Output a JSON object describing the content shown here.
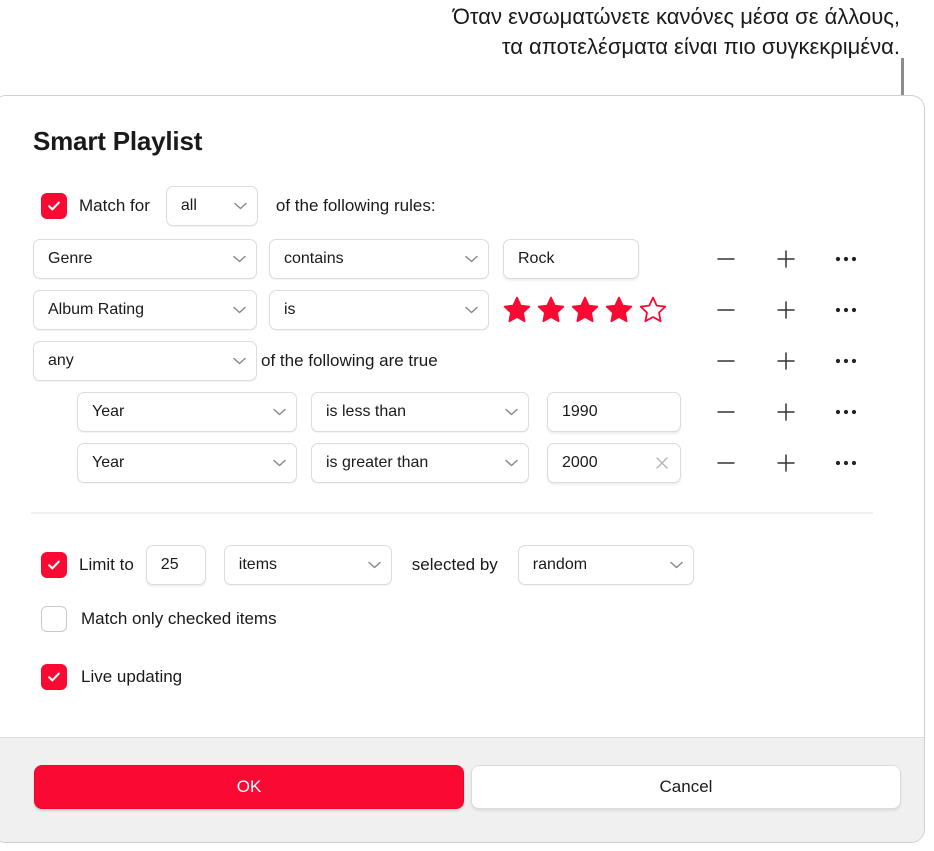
{
  "callout": {
    "text": "Όταν ενσωματώνετε κανόνες μέσα σε άλλους,\nτα αποτελέσματα είναι πιο συγκεκριμένα."
  },
  "dialog": {
    "title": "Smart Playlist",
    "match_row": {
      "checkbox_checked": true,
      "label_before": "Match  for",
      "selector_value": "all",
      "label_after": "of the following rules:"
    },
    "rules": [
      {
        "field": "Genre",
        "operator": "contains",
        "value": "Rock",
        "value_type": "text",
        "clearable": false,
        "nested": false
      },
      {
        "field": "Album Rating",
        "operator": "is",
        "value_type": "stars",
        "stars_filled": 4,
        "stars_total": 5,
        "nested": false
      },
      {
        "field": "any",
        "value_type": "group",
        "group_label": "of the following are true",
        "nested": false
      },
      {
        "field": "Year",
        "operator": "is less than",
        "value": "1990",
        "value_type": "text",
        "clearable": false,
        "nested": true
      },
      {
        "field": "Year",
        "operator": "is greater than",
        "value": "2000",
        "value_type": "text",
        "clearable": true,
        "nested": true
      }
    ],
    "row_actions": {
      "remove": "−",
      "add": "+",
      "more": "•••"
    },
    "limit_row": {
      "checkbox_checked": true,
      "label": "Limit to",
      "amount": "25",
      "unit": "items",
      "selected_by_label": "selected by",
      "selected_by": "random"
    },
    "options": [
      {
        "label": "Match only checked items",
        "checked": false
      },
      {
        "label": "Live updating",
        "checked": true
      }
    ],
    "footer": {
      "ok_label": "OK",
      "cancel_label": "Cancel"
    }
  },
  "colors": {
    "accent_red": "#fa0a32",
    "star_red": "#fa0a32",
    "text": "#1a1a1a",
    "border": "#dcdcdc",
    "footer_bg": "#f0f0f0",
    "leader": "#8c8c8c"
  }
}
